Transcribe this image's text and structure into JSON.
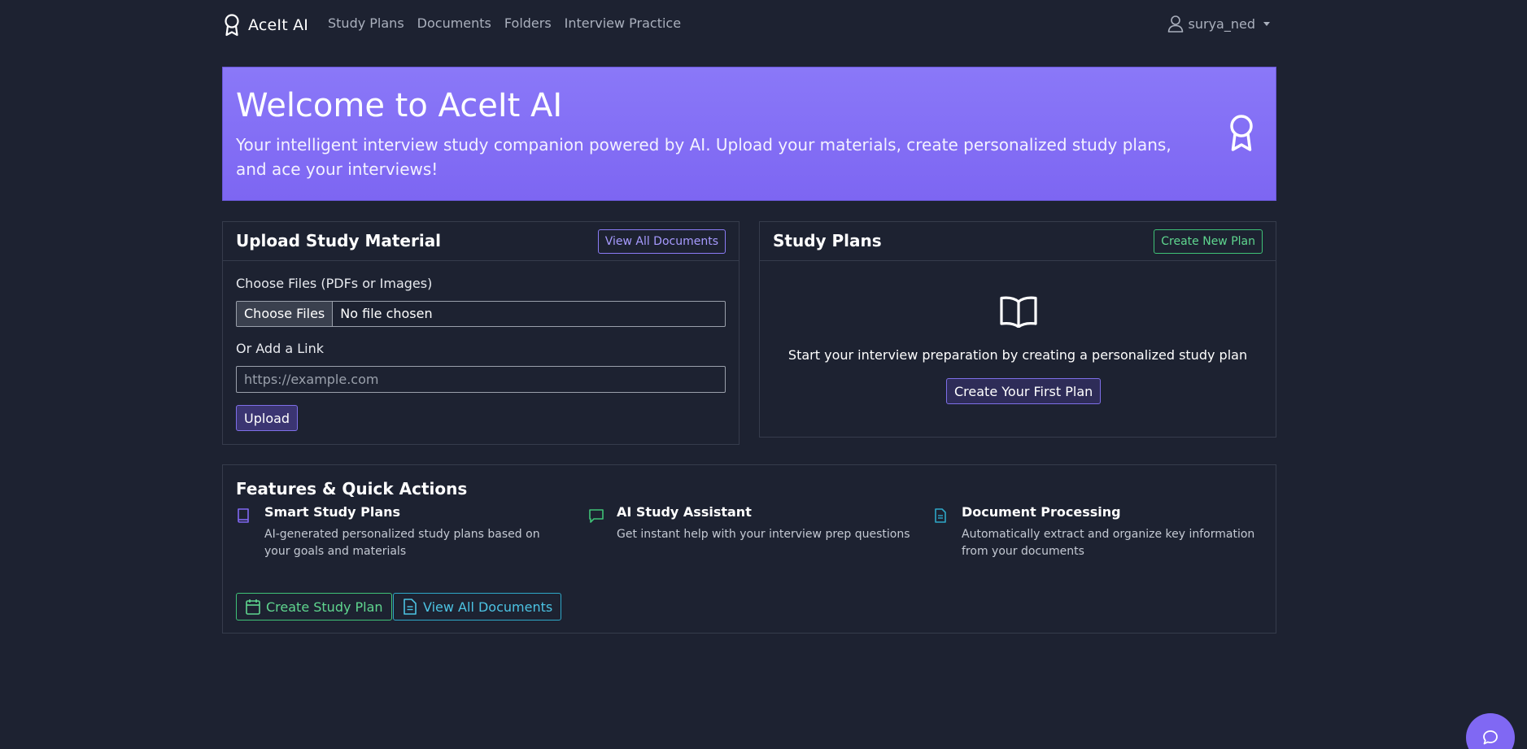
{
  "nav": {
    "brand": "AceIt AI",
    "links": [
      "Study Plans",
      "Documents",
      "Folders",
      "Interview Practice"
    ],
    "user": "surya_ned"
  },
  "hero": {
    "title": "Welcome to AceIt AI",
    "subtitle": "Your intelligent interview study companion powered by AI. Upload your materials, create personalized study plans, and ace your interviews!"
  },
  "upload": {
    "title": "Upload Study Material",
    "view_all_button": "View All Documents",
    "files_label": "Choose Files (PDFs or Images)",
    "choose_files_button": "Choose Files",
    "file_status": "No file chosen",
    "link_label": "Or Add a Link",
    "link_placeholder": "https://example.com",
    "link_value": "",
    "upload_button": "Upload"
  },
  "plans": {
    "title": "Study Plans",
    "create_new_button": "Create New Plan",
    "empty_text": "Start your interview preparation by creating a personalized study plan",
    "first_plan_button": "Create Your First Plan"
  },
  "features": {
    "title": "Features & Quick Actions",
    "items": [
      {
        "title": "Smart Study Plans",
        "desc": "AI-generated personalized study plans based on your goals and materials",
        "icon": "book-icon",
        "color": "#8068f3"
      },
      {
        "title": "AI Study Assistant",
        "desc": "Get instant help with your interview prep questions",
        "icon": "chat-icon",
        "color": "#3fc277"
      },
      {
        "title": "Document Processing",
        "desc": "Automatically extract and organize key information from your documents",
        "icon": "document-icon",
        "color": "#2ea7c7"
      }
    ],
    "create_plan_button": "Create Study Plan",
    "view_docs_button": "View All Documents"
  },
  "colors": {
    "background": "#1d2231",
    "accent_purple": "#8068f3",
    "accent_green": "#3fc277",
    "accent_cyan": "#2ea7c7"
  }
}
